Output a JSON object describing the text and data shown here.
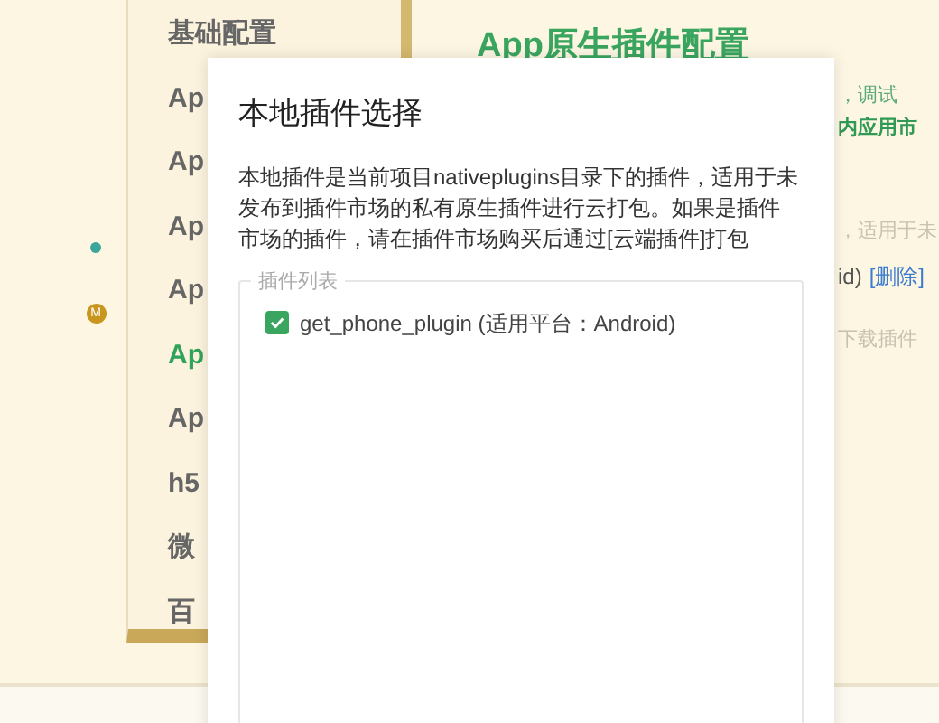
{
  "rail": {
    "markers": [
      {
        "kind": "dot",
        "color": "#3aa59a"
      },
      {
        "kind": "badge",
        "label": "M",
        "color": "#c8961e"
      }
    ]
  },
  "sidebar": {
    "items": [
      {
        "label": "基础配置",
        "selected": false
      },
      {
        "label": "Ap",
        "selected": false
      },
      {
        "label": "Ap",
        "selected": false
      },
      {
        "label": "Ap",
        "selected": false
      },
      {
        "label": "Ap",
        "selected": false
      },
      {
        "label": "Ap",
        "selected": true
      },
      {
        "label": "Ap",
        "selected": false
      },
      {
        "label": "h5",
        "selected": false
      },
      {
        "label": "微",
        "selected": false
      },
      {
        "label": "百",
        "selected": false
      }
    ]
  },
  "content": {
    "title": "App原生插件配置",
    "lines": [
      {
        "kind": "note",
        "text": "，调试"
      },
      {
        "kind": "strong",
        "text": "内应用市"
      },
      {
        "kind": "muted",
        "text": "，适用于未"
      },
      {
        "kind": "plugin",
        "text": "id)",
        "link": "[删除]"
      },
      {
        "kind": "muted",
        "text": "下载插件"
      }
    ]
  },
  "dialog": {
    "title": "本地插件选择",
    "description": "本地插件是当前项目nativeplugins目录下的插件，适用于未发布到插件市场的私有原生插件进行云打包。如果是插件市场的插件，请在插件市场购买后通过[云端插件]打包",
    "group": {
      "legend": "插件列表",
      "plugins": [
        {
          "name": "get_phone_plugin",
          "platform": "(适用平台：Android)",
          "checked": true
        }
      ]
    }
  }
}
